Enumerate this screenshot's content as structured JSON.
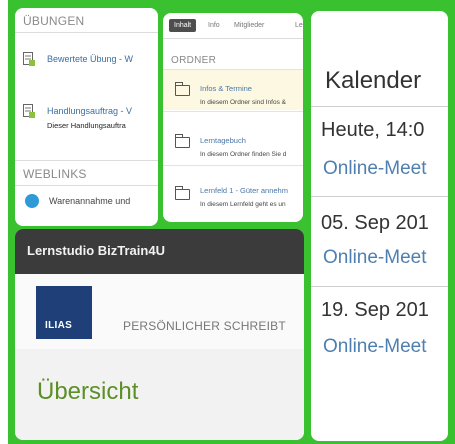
{
  "uebungen": {
    "heading": "ÜBUNGEN",
    "items": [
      {
        "title": "Bewertete Übung - W",
        "sub": ""
      },
      {
        "title": "Handlungsauftrag - V",
        "sub": "Dieser Handlungsauftra"
      }
    ]
  },
  "weblinks": {
    "heading": "WEBLINKS",
    "items": [
      {
        "title": "Warenannahme und"
      }
    ]
  },
  "ordner_panel": {
    "tabs": [
      {
        "label": "Inhalt",
        "active": true
      },
      {
        "label": "Info",
        "active": false
      },
      {
        "label": "Mitglieder",
        "active": false
      },
      {
        "label": "Le",
        "active": false
      }
    ],
    "heading": "ORDNER",
    "folders": [
      {
        "title": "Infos & Termine",
        "sub": "In diesem Ordner sind Infos &"
      },
      {
        "title": "Lerntagebuch",
        "sub": "In diesem Ordner finden Sie d"
      },
      {
        "title": "Lernfeld 1 - Güter annehm",
        "sub": "In diesem Lernfeld geht es un"
      }
    ]
  },
  "lernstudio": {
    "title": "Lernstudio BizTrain4U",
    "logo_text": "ILIAS",
    "desk_label": "PERSÖNLICHER SCHREIBT",
    "overview": "Übersicht"
  },
  "kalender": {
    "title": "Kalender",
    "entries": [
      {
        "date": "Heute, 14:0",
        "event": "Online-Meet"
      },
      {
        "date": "05. Sep 201",
        "event": "Online-Meet"
      },
      {
        "date": "19. Sep 201",
        "event": "Online-Meet"
      }
    ]
  },
  "colors": {
    "frame_green": "#39c12f",
    "ilias_blue": "#1e3f78",
    "overview_green": "#5d8f28",
    "link_blue": "#4f7fb0"
  }
}
